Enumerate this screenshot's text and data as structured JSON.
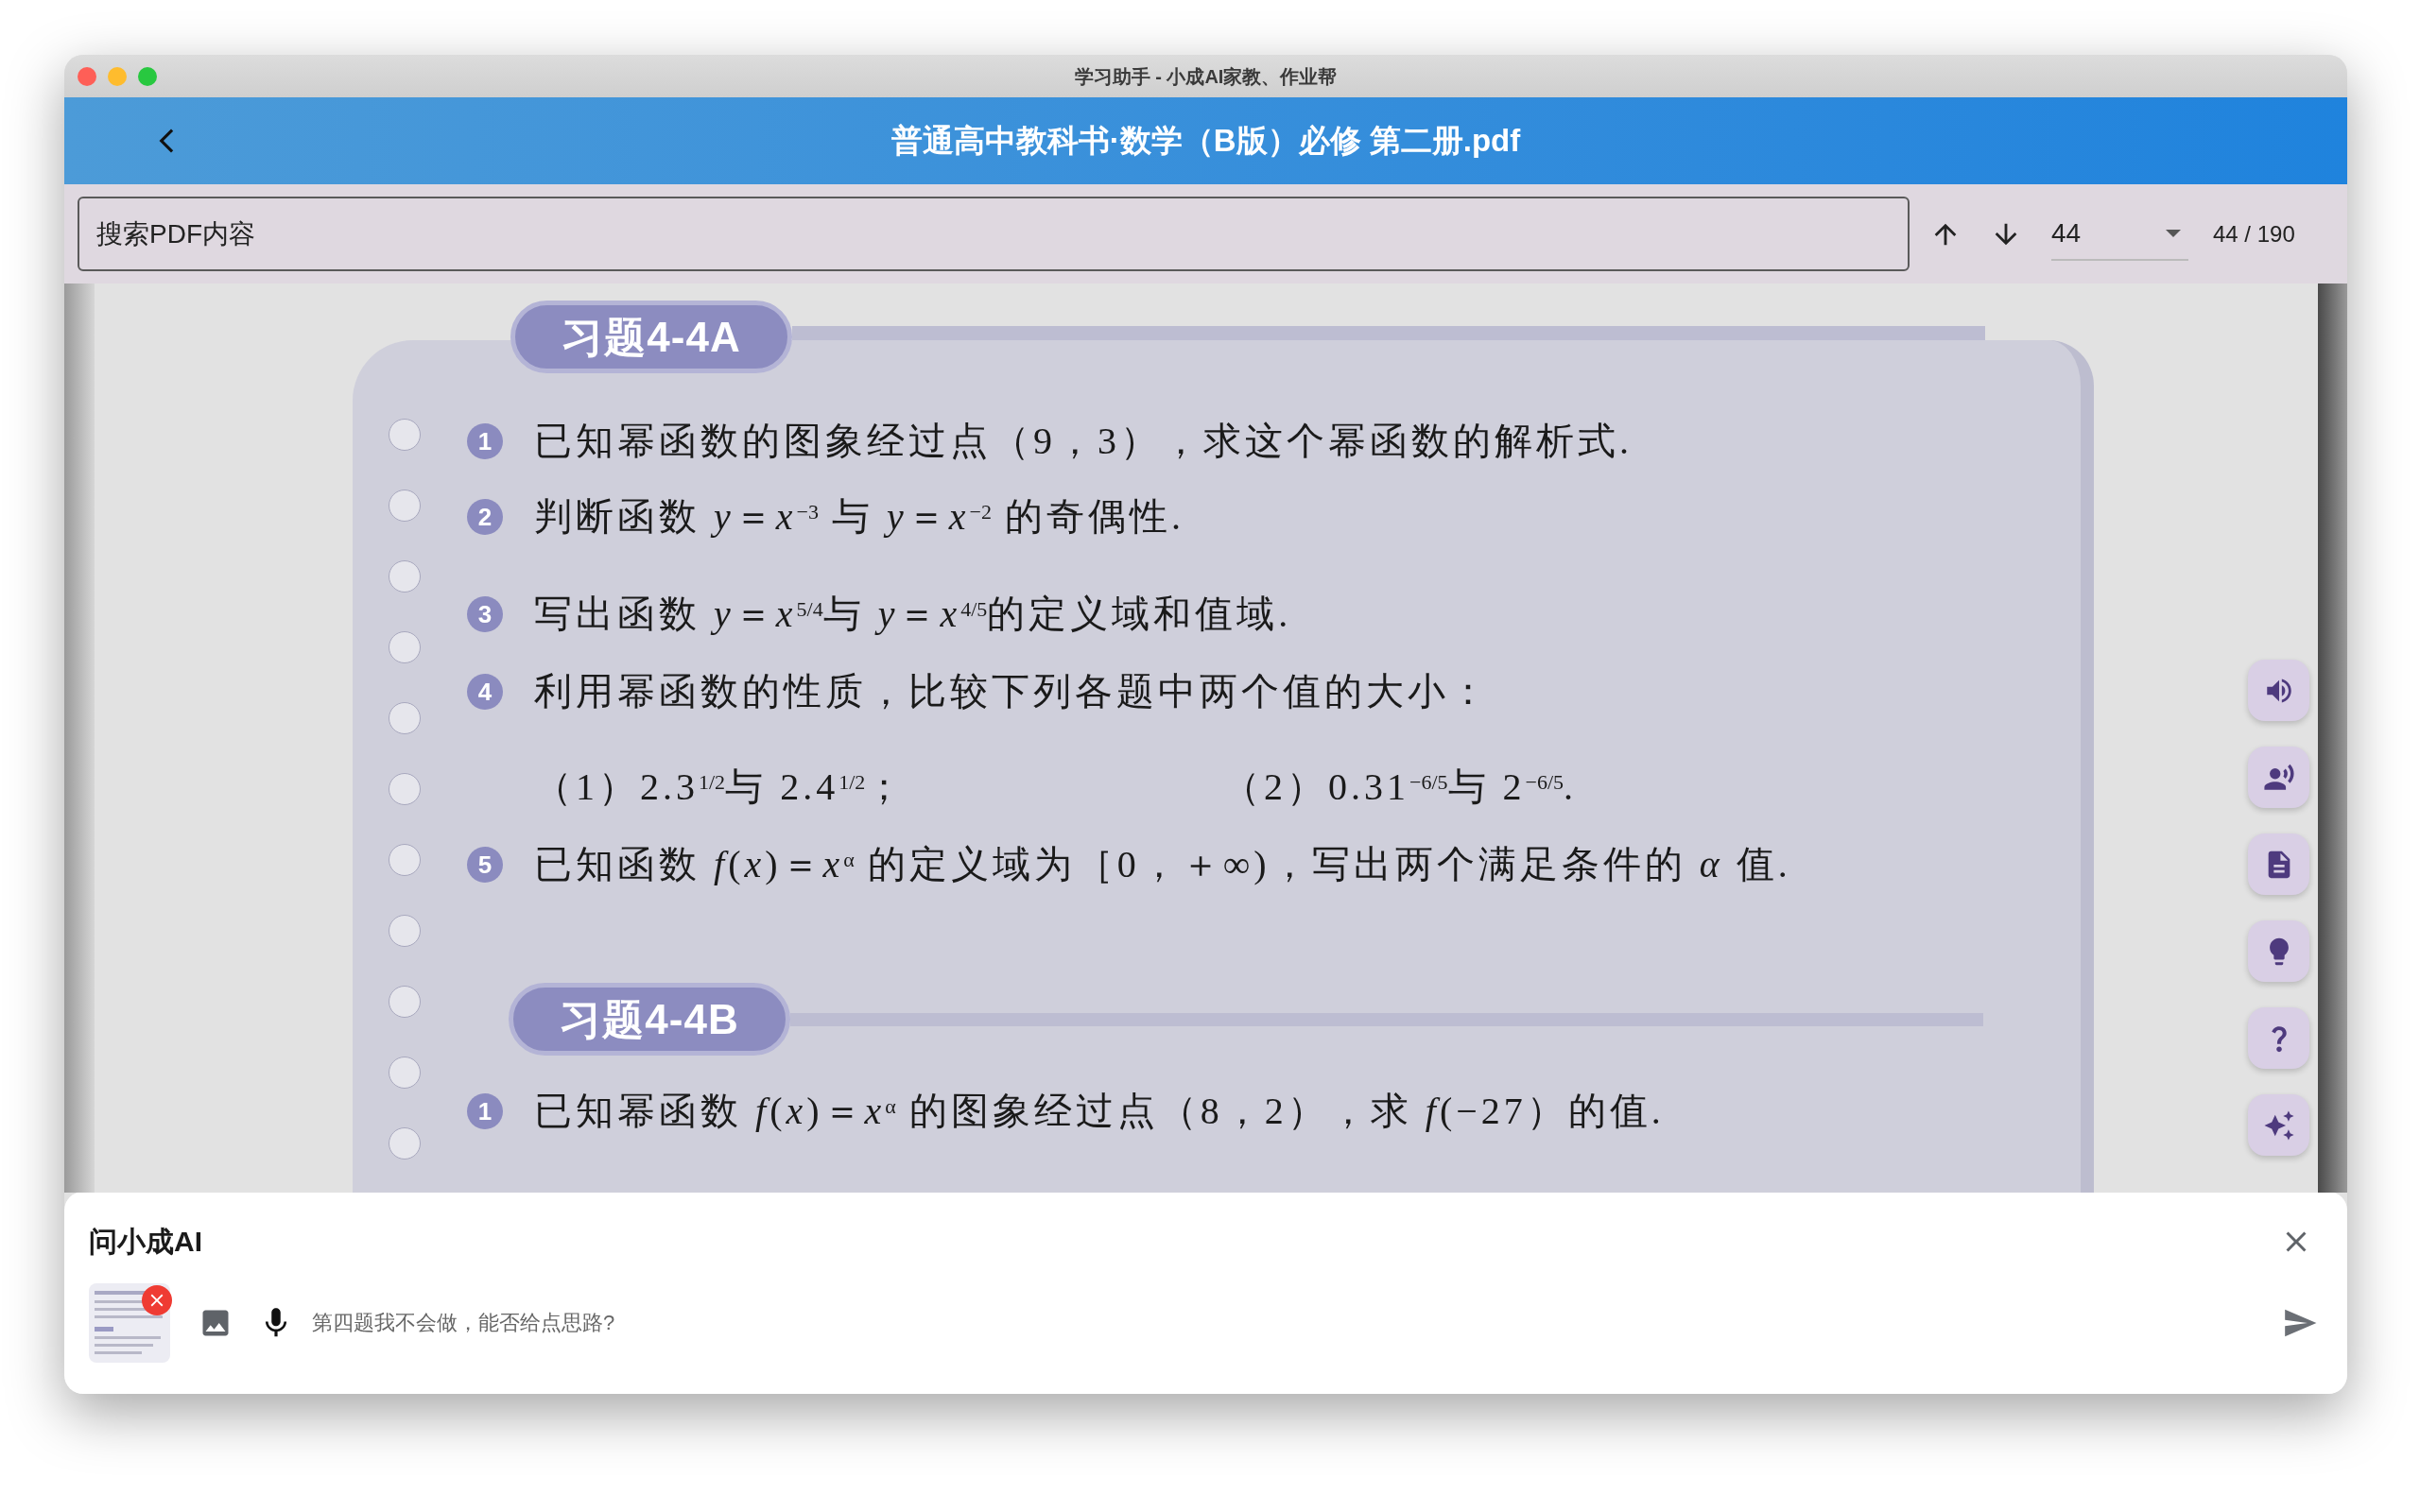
{
  "window": {
    "title": "学习助手 - 小成AI家教、作业帮"
  },
  "header": {
    "title": "普通高中教科书·数学（B版）必修 第二册.pdf"
  },
  "search": {
    "placeholder": "搜索PDF内容",
    "page_value": "44",
    "page_count": "44 / 190"
  },
  "sections": [
    {
      "title": "习题4-4A",
      "exercises": [
        {
          "number": "1",
          "text": "已知幂函数的图象经过点（9，3），求这个幂函数的解析式."
        },
        {
          "number": "2",
          "text": "判断函数 *y*＝*x*$^{−3}$ 与 *y*＝*x*$^{−2}$ 的奇偶性."
        },
        {
          "number": "3",
          "text": "写出函数 *y*＝*x*$^{5/4}$与 *y*＝*x*$^{4/5}$的定义域和值域."
        },
        {
          "number": "4",
          "text": "利用幂函数的性质，比较下列各题中两个值的大小：",
          "parts": [
            "（1）2.3$^{1/2}$与 2.4$^{1/2}$；",
            "（2）0.31$^{−6/5}$与 2$^{−6/5}$."
          ]
        },
        {
          "number": "5",
          "text": "已知函数 *f*(*x*)＝*x*$^{α}$ 的定义域为［0，＋∞)，写出两个满足条件的 *α* 值."
        }
      ]
    },
    {
      "title": "习题4-4B",
      "exercises": [
        {
          "number": "1",
          "text": "已知幂函数 *f*(*x*)＝*x*$^{α}$ 的图象经过点（8，2），求 *f*(−27）的值."
        }
      ]
    }
  ],
  "ai_panel": {
    "title": "问小成AI",
    "input": {
      "placeholder": "第四题我不会做，能否给点思路?"
    }
  }
}
